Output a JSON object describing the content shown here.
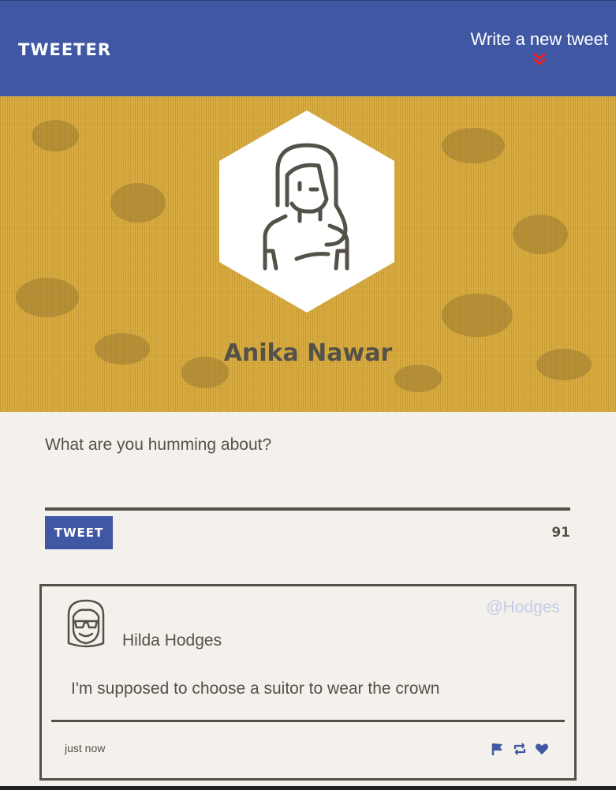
{
  "header": {
    "brand": "TWEETER",
    "write_link": "Write a new tweet",
    "chevron_icon": "double-chevron-down-icon",
    "bg_color": "#4058a4",
    "chevron_color": "#e8232a"
  },
  "profile": {
    "name": "Anika Nawar",
    "avatar_icon": "person-avatar-icon",
    "banner_color": "#d7a93c"
  },
  "compose": {
    "placeholder": "What are you humming about?",
    "button_label": "TWEET",
    "char_count": "91"
  },
  "tweets": [
    {
      "author": "Hilda Hodges",
      "handle": "@Hodges",
      "text": "I'm supposed to choose a suitor to wear the crown",
      "time": "just now",
      "avatar_icon": "person-with-sunglasses-icon",
      "actions": [
        "flag-icon",
        "retweet-icon",
        "heart-icon"
      ]
    }
  ],
  "colors": {
    "accent": "#4058a4",
    "text": "#545149",
    "background": "#f4f1ec",
    "handle": "#c3cbe6"
  }
}
